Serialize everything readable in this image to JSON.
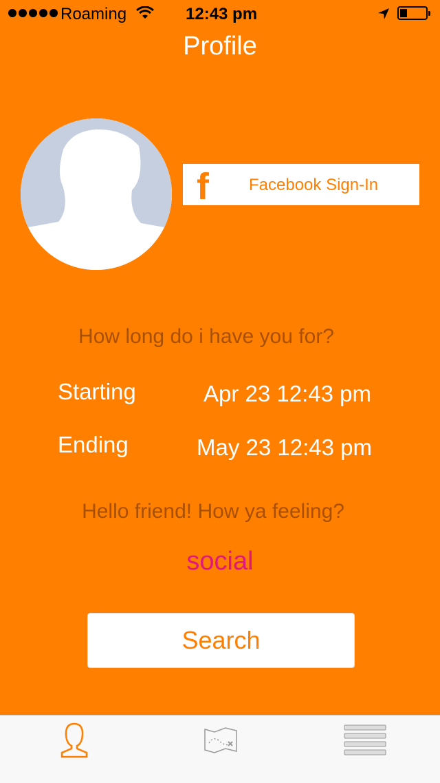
{
  "status_bar": {
    "carrier": "Roaming",
    "time": "12:43 pm",
    "signal_bars": 5,
    "battery_level": 0.2
  },
  "header": {
    "title": "Profile"
  },
  "profile": {
    "facebook_icon": "f",
    "facebook_label": "Facebook Sign-In"
  },
  "duration": {
    "question": "How long do i have you for?",
    "start_label": "Starting",
    "start_value": "Apr 23 12:43 pm",
    "end_label": "Ending",
    "end_value": "May 23 12:43 pm"
  },
  "mood": {
    "greeting": "Hello friend! How ya feeling?",
    "value": "social"
  },
  "search_label": "Search",
  "tabs": [
    {
      "icon": "profile-icon",
      "active": true
    },
    {
      "icon": "map-icon",
      "active": false
    },
    {
      "icon": "list-icon",
      "active": false
    }
  ],
  "colors": {
    "background": "#ff7f00",
    "muted_text": "#a85000",
    "accent_pink": "#e0197a",
    "tab_active": "#ff7f00"
  }
}
